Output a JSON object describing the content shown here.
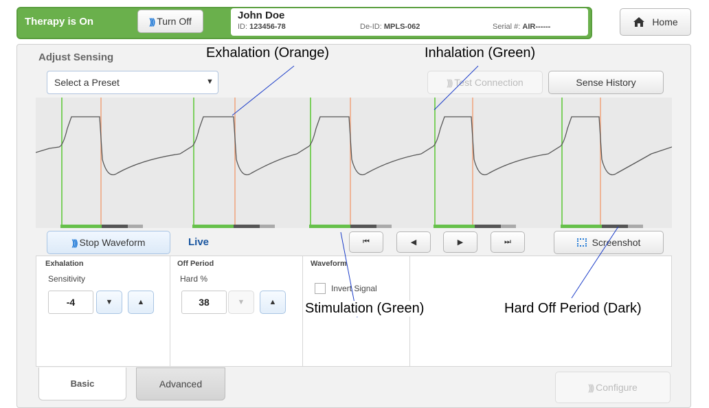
{
  "header": {
    "therapy_status": "Therapy is On",
    "turn_off_label": "Turn Off",
    "patient_name": "John Doe",
    "id_label": "ID:",
    "id_value": "123456-78",
    "deid_label": "De-ID:",
    "deid_value": "MPLS-062",
    "serial_label": "Serial #:",
    "serial_value": "AIR------",
    "home_label": "Home"
  },
  "panel": {
    "title": "Adjust Sensing",
    "preset_placeholder": "Select a Preset",
    "test_connection_label": "Test Connection",
    "sense_history_label": "Sense History"
  },
  "controls": {
    "stop_waveform_label": "Stop Waveform",
    "live_label": "Live",
    "nav_first": "⏮",
    "nav_prev": "◀",
    "nav_next": "▶",
    "nav_last": "⏭",
    "screenshot_label": "Screenshot"
  },
  "settings": {
    "exhalation": {
      "title": "Exhalation",
      "sub": "Sensitivity",
      "value": "-4"
    },
    "off_period": {
      "title": "Off Period",
      "sub": "Hard %",
      "value": "38"
    },
    "waveform": {
      "title": "Waveform",
      "invert_label": "Invert Signal"
    }
  },
  "tabs": {
    "basic": "Basic",
    "advanced": "Advanced"
  },
  "configure_label": "Configure",
  "annotations": {
    "exhalation": "Exhalation (Orange)",
    "inhalation": "Inhalation (Green)",
    "stimulation": "Stimulation (Green)",
    "hard_off": "Hard Off Period (Dark)"
  },
  "colors": {
    "therapy_green": "#6ab04c",
    "inhalation_marker": "#7ccf5e",
    "exhalation_marker": "#f0a27a",
    "stim_bar": "#66c04a",
    "hard_off_bar": "#555555",
    "soft_off_bar": "#aaaaaa",
    "accent_blue": "#1e78d6"
  }
}
